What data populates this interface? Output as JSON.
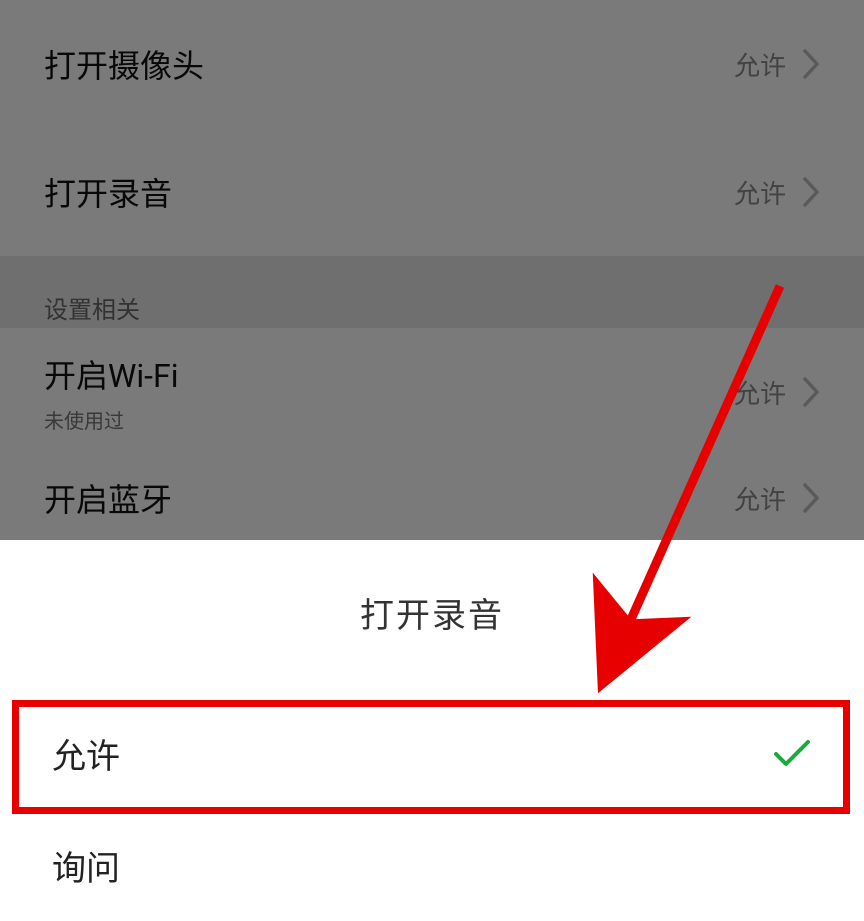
{
  "settings": {
    "rows": [
      {
        "label": "打开摄像头",
        "value": "允许"
      },
      {
        "label": "打开录音",
        "value": "允许"
      }
    ],
    "section_label": "设置相关",
    "rows2": [
      {
        "label": "开启Wi-Fi",
        "sub": "未使用过",
        "value": "允许"
      },
      {
        "label": "开启蓝牙",
        "sub": "",
        "value": "允许"
      }
    ]
  },
  "sheet": {
    "title": "打开录音",
    "options": [
      {
        "label": "允许",
        "selected": true
      },
      {
        "label": "询问",
        "selected": false
      }
    ]
  },
  "icons": {
    "chevron_right": "chevron-right-icon",
    "check": "check-icon"
  }
}
